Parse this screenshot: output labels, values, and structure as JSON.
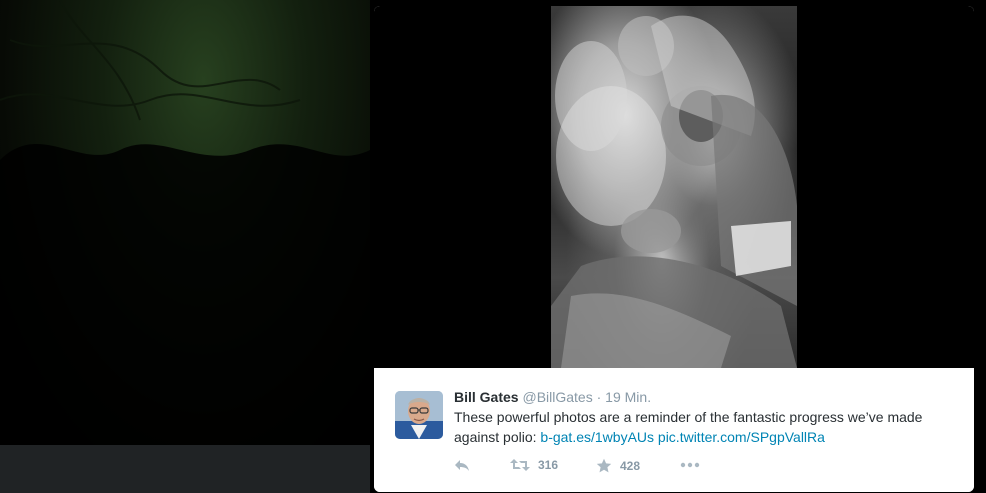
{
  "tweet": {
    "author_name": "Bill Gates",
    "author_handle": "@BillGates",
    "separator": "·",
    "time": "19 Min.",
    "text_before": "These powerful photos are a reminder of the fantastic progress we’ve made against polio: ",
    "link1": "b-gat.es/1wbyAUs",
    "link2": "pic.twitter.com/SPgpVallRa",
    "retweet_count": "316",
    "favorite_count": "428"
  },
  "icons": {
    "reply": "reply-icon",
    "retweet": "retweet-icon",
    "favorite": "star-icon",
    "more": "more-icon"
  },
  "colors": {
    "link": "#0084b4",
    "muted": "#8899a6",
    "text": "#292f33"
  }
}
